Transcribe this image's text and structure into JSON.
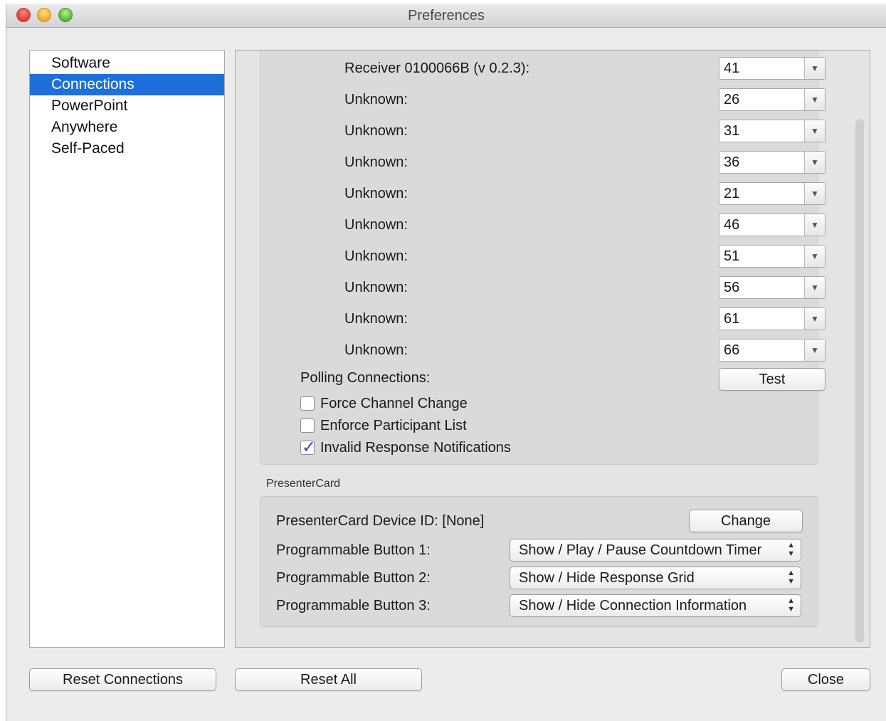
{
  "window": {
    "title": "Preferences"
  },
  "sidebar": {
    "items": [
      {
        "label": "Software"
      },
      {
        "label": "Connections"
      },
      {
        "label": "PowerPoint"
      },
      {
        "label": "Anywhere"
      },
      {
        "label": "Self-Paced"
      }
    ],
    "selected": "Connections"
  },
  "connections": {
    "receivers": [
      {
        "label": "Receiver 0100066B (v 0.2.3):",
        "channel": "41"
      },
      {
        "label": "Unknown:",
        "channel": "26"
      },
      {
        "label": "Unknown:",
        "channel": "31"
      },
      {
        "label": "Unknown:",
        "channel": "36"
      },
      {
        "label": "Unknown:",
        "channel": "21"
      },
      {
        "label": "Unknown:",
        "channel": "46"
      },
      {
        "label": "Unknown:",
        "channel": "51"
      },
      {
        "label": "Unknown:",
        "channel": "56"
      },
      {
        "label": "Unknown:",
        "channel": "61"
      },
      {
        "label": "Unknown:",
        "channel": "66"
      }
    ],
    "polling_label": "Polling Connections:",
    "test_button": "Test",
    "options": [
      {
        "label": "Force Channel Change",
        "checked": false
      },
      {
        "label": "Enforce Participant List",
        "checked": false
      },
      {
        "label": "Invalid Response Notifications",
        "checked": true
      }
    ]
  },
  "presentercard": {
    "caption": "PresenterCard",
    "device_id_label": "PresenterCard Device ID: [None]",
    "change_button": "Change",
    "buttons": [
      {
        "label": "Programmable Button 1:",
        "value": "Show / Play / Pause Countdown Timer"
      },
      {
        "label": "Programmable Button 2:",
        "value": "Show / Hide Response Grid"
      },
      {
        "label": "Programmable Button 3:",
        "value": "Show / Hide Connection Information"
      }
    ]
  },
  "footer": {
    "reset_connections": "Reset Connections",
    "reset_all": "Reset All",
    "close": "Close"
  },
  "icons": {
    "dropdown_arrow": "chevron-down-icon",
    "popup_arrows": "up-down-arrows-icon",
    "checkmark": "checkmark-icon"
  },
  "colors": {
    "selection": "#1e6fd9",
    "checkmark": "#2556a8"
  }
}
